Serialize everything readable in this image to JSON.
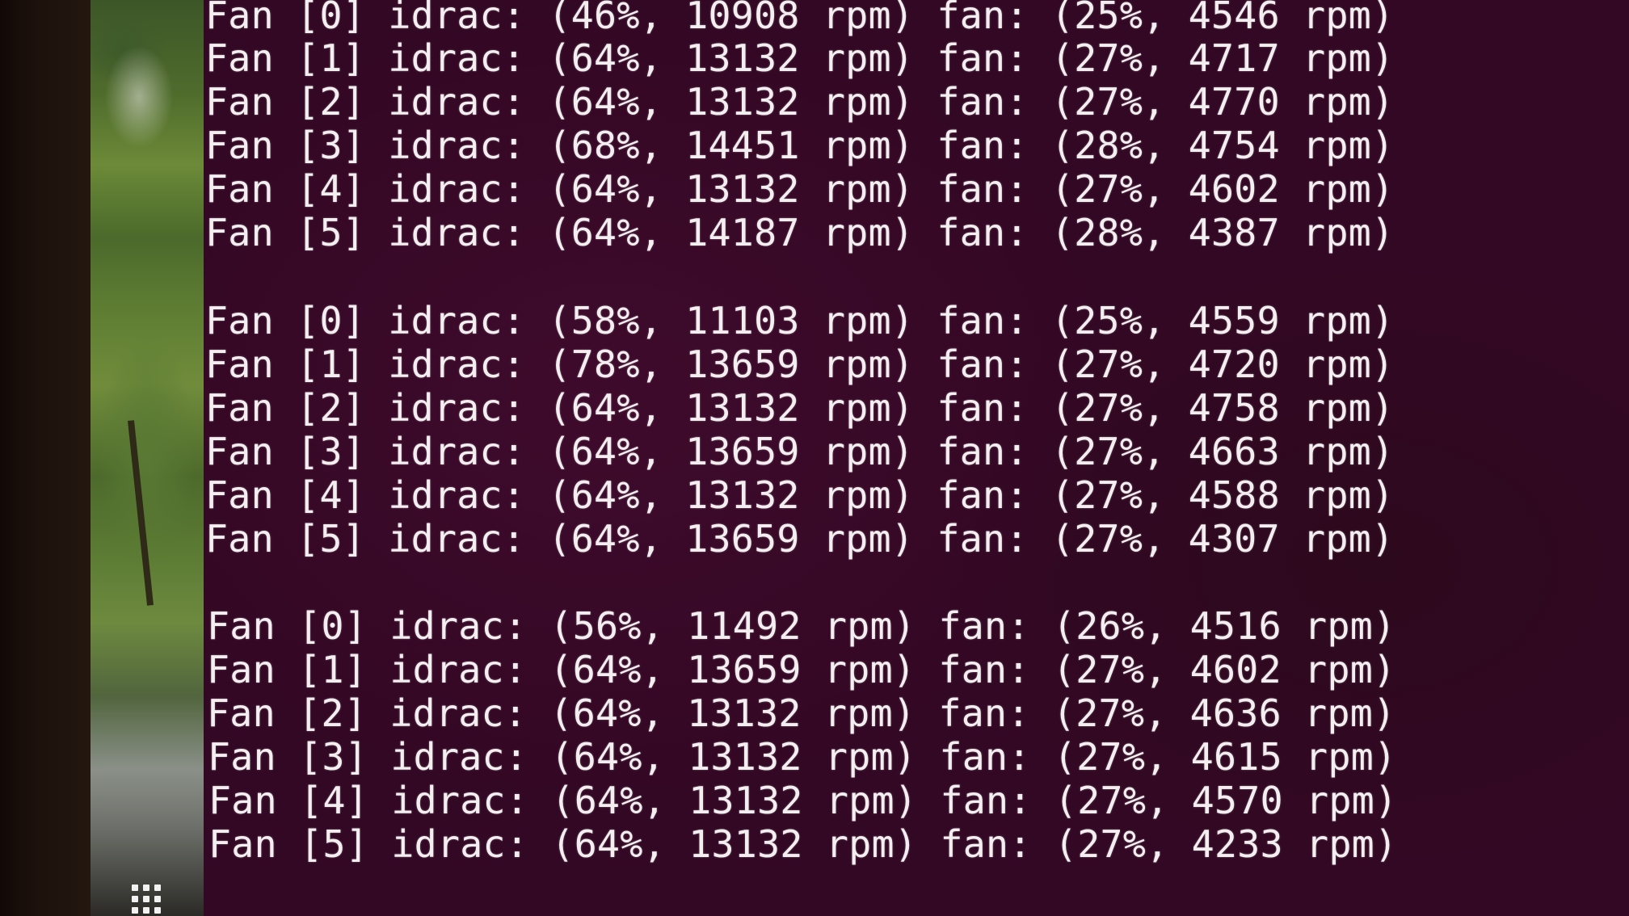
{
  "terminal": {
    "lines": [
      "Fan [0] idrac: (46%, 10908 rpm) fan: (25%, 4546 rpm)",
      "Fan [1] idrac: (64%, 13132 rpm) fan: (27%, 4717 rpm)",
      "Fan [2] idrac: (64%, 13132 rpm) fan: (27%, 4770 rpm)",
      "Fan [3] idrac: (68%, 14451 rpm) fan: (28%, 4754 rpm)",
      "Fan [4] idrac: (64%, 13132 rpm) fan: (27%, 4602 rpm)",
      "Fan [5] idrac: (64%, 14187 rpm) fan: (28%, 4387 rpm)",
      "",
      "Fan [0] idrac: (58%, 11103 rpm) fan: (25%, 4559 rpm)",
      "Fan [1] idrac: (78%, 13659 rpm) fan: (27%, 4720 rpm)",
      "Fan [2] idrac: (64%, 13132 rpm) fan: (27%, 4758 rpm)",
      "Fan [3] idrac: (64%, 13659 rpm) fan: (27%, 4663 rpm)",
      "Fan [4] idrac: (64%, 13132 rpm) fan: (27%, 4588 rpm)",
      "Fan [5] idrac: (64%, 13659 rpm) fan: (27%, 4307 rpm)",
      "",
      "Fan [0] idrac: (56%, 11492 rpm) fan: (26%, 4516 rpm)",
      "Fan [1] idrac: (64%, 13659 rpm) fan: (27%, 4602 rpm)",
      "Fan [2] idrac: (64%, 13132 rpm) fan: (27%, 4636 rpm)",
      "Fan [3] idrac: (64%, 13132 rpm) fan: (27%, 4615 rpm)",
      "Fan [4] idrac: (64%, 13132 rpm) fan: (27%, 4570 rpm)",
      "Fan [5] idrac: (64%, 13132 rpm) fan: (27%, 4233 rpm)"
    ]
  },
  "dock": {
    "apps_icon": "apps-grid-icon"
  },
  "colors": {
    "terminal_background": "#300a25",
    "terminal_text": "#f3eef0"
  }
}
